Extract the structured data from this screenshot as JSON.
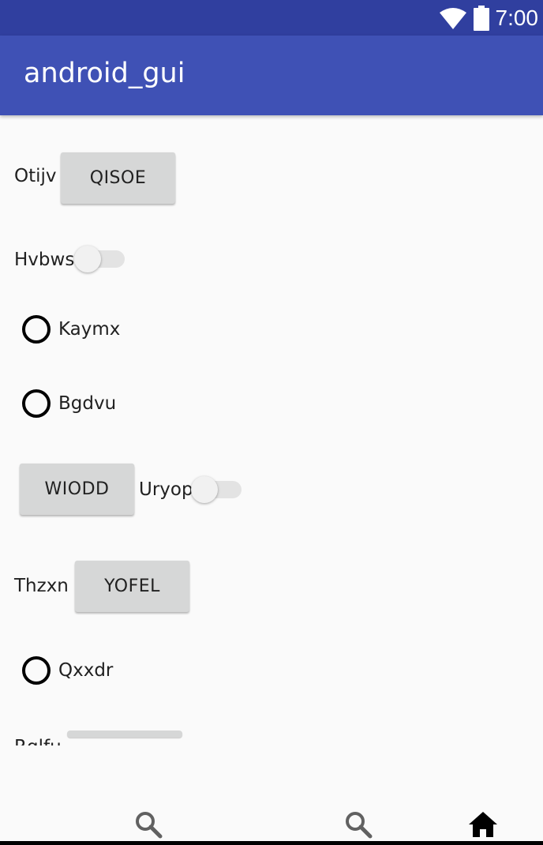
{
  "status_bar": {
    "time": "7:00",
    "icons": [
      "wifi-icon",
      "battery-icon"
    ]
  },
  "app_bar": {
    "title": "android_gui"
  },
  "content": {
    "row1": {
      "label": "Otijv",
      "button": "QISOE"
    },
    "row2": {
      "label": "Hvbws",
      "switch_on": false
    },
    "radio1": {
      "label": "Kaymx",
      "checked": false
    },
    "radio2": {
      "label": "Bgdvu",
      "checked": false
    },
    "row5": {
      "button": "WIODD",
      "label": "Uryop",
      "switch_on": false
    },
    "row6": {
      "label": "Thzxn",
      "button": "YOFEL"
    },
    "radio3": {
      "label": "Qxxdr",
      "checked": false
    },
    "row8": {
      "label": "Rglfu"
    }
  },
  "bottom_nav": {
    "icons": [
      "search-icon",
      "search-icon",
      "home-icon"
    ]
  },
  "colors": {
    "status_bar": "#303f9f",
    "app_bar": "#3f51b5",
    "background": "#fafafa",
    "button": "#d6d7d7"
  }
}
